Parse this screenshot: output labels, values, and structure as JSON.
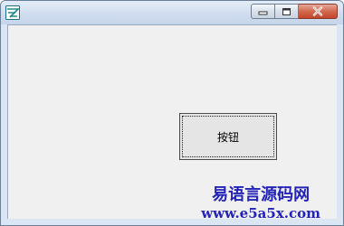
{
  "window": {
    "caption_buttons": {
      "minimize_icon": "minimize-icon",
      "maximize_icon": "maximize-icon",
      "close_icon": "close-icon"
    }
  },
  "form": {
    "button_label": "按钮"
  },
  "watermark": {
    "title": "易语言源码网",
    "url": "www.e5a5x.com",
    "color": "#2323b8"
  }
}
